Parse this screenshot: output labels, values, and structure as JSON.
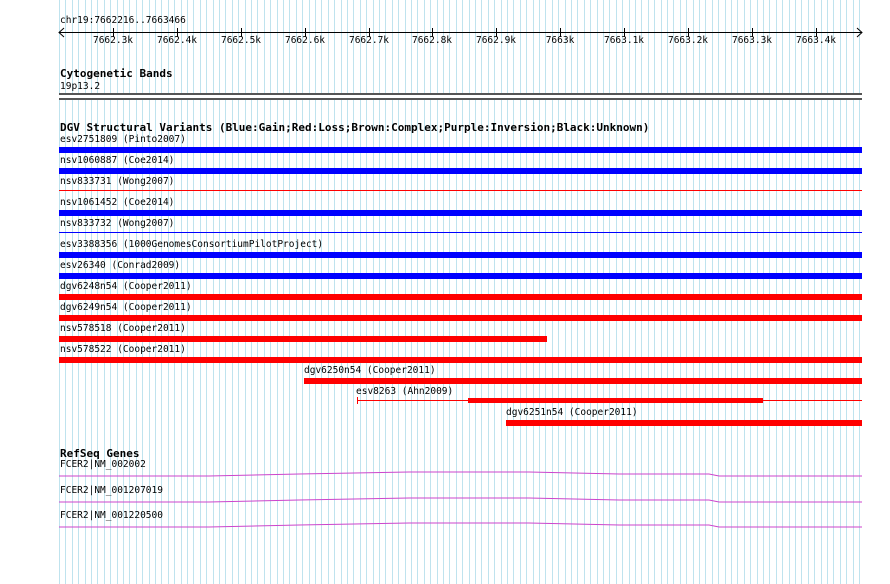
{
  "ruler": {
    "location": "chr19:7662216..7663466",
    "ticks": [
      "7662.3k",
      "7662.4k",
      "7662.5k",
      "7662.6k",
      "7662.7k",
      "7662.8k",
      "7662.9k",
      "7663k",
      "7663.1k",
      "7663.2k",
      "7663.3k",
      "7663.4k"
    ]
  },
  "cytobands": {
    "title": "Cytogenetic Bands",
    "band_name": "19p13.2"
  },
  "dgv": {
    "title": "DGV Structural Variants (Blue:Gain;Red:Loss;Brown:Complex;Purple:Inversion;Black:Unknown)",
    "colors": {
      "gain": "#0000ff",
      "loss": "#ff0000"
    },
    "features": [
      {
        "label": "esv2751809 (Pinto2007)",
        "type": "gain"
      },
      {
        "label": "nsv1060887 (Coe2014)",
        "type": "gain"
      },
      {
        "label": "nsv833731 (Wong2007)",
        "type": "loss"
      },
      {
        "label": "nsv1061452 (Coe2014)",
        "type": "gain"
      },
      {
        "label": "nsv833732 (Wong2007)",
        "type": "gain"
      },
      {
        "label": "esv3388356 (1000GenomesConsortiumPilotProject)",
        "type": "gain"
      },
      {
        "label": "esv26340 (Conrad2009)",
        "type": "gain"
      },
      {
        "label": "dgv6248n54 (Cooper2011)",
        "type": "loss"
      },
      {
        "label": "dgv6249n54 (Cooper2011)",
        "type": "loss"
      },
      {
        "label": "nsv578518 (Cooper2011)",
        "type": "loss"
      },
      {
        "label": "nsv578522 (Cooper2011)",
        "type": "loss"
      },
      {
        "label": "dgv6250n54 (Cooper2011)",
        "type": "loss"
      },
      {
        "label": "esv8263 (Ahn2009)",
        "type": "loss"
      },
      {
        "label": "dgv6251n54 (Cooper2011)",
        "type": "loss"
      }
    ]
  },
  "refseq": {
    "title": "RefSeq Genes",
    "color": "#cc44cc",
    "genes": [
      {
        "label": "FCER2|NM_002002"
      },
      {
        "label": "FCER2|NM_001207019"
      },
      {
        "label": "FCER2|NM_001220500"
      }
    ]
  }
}
